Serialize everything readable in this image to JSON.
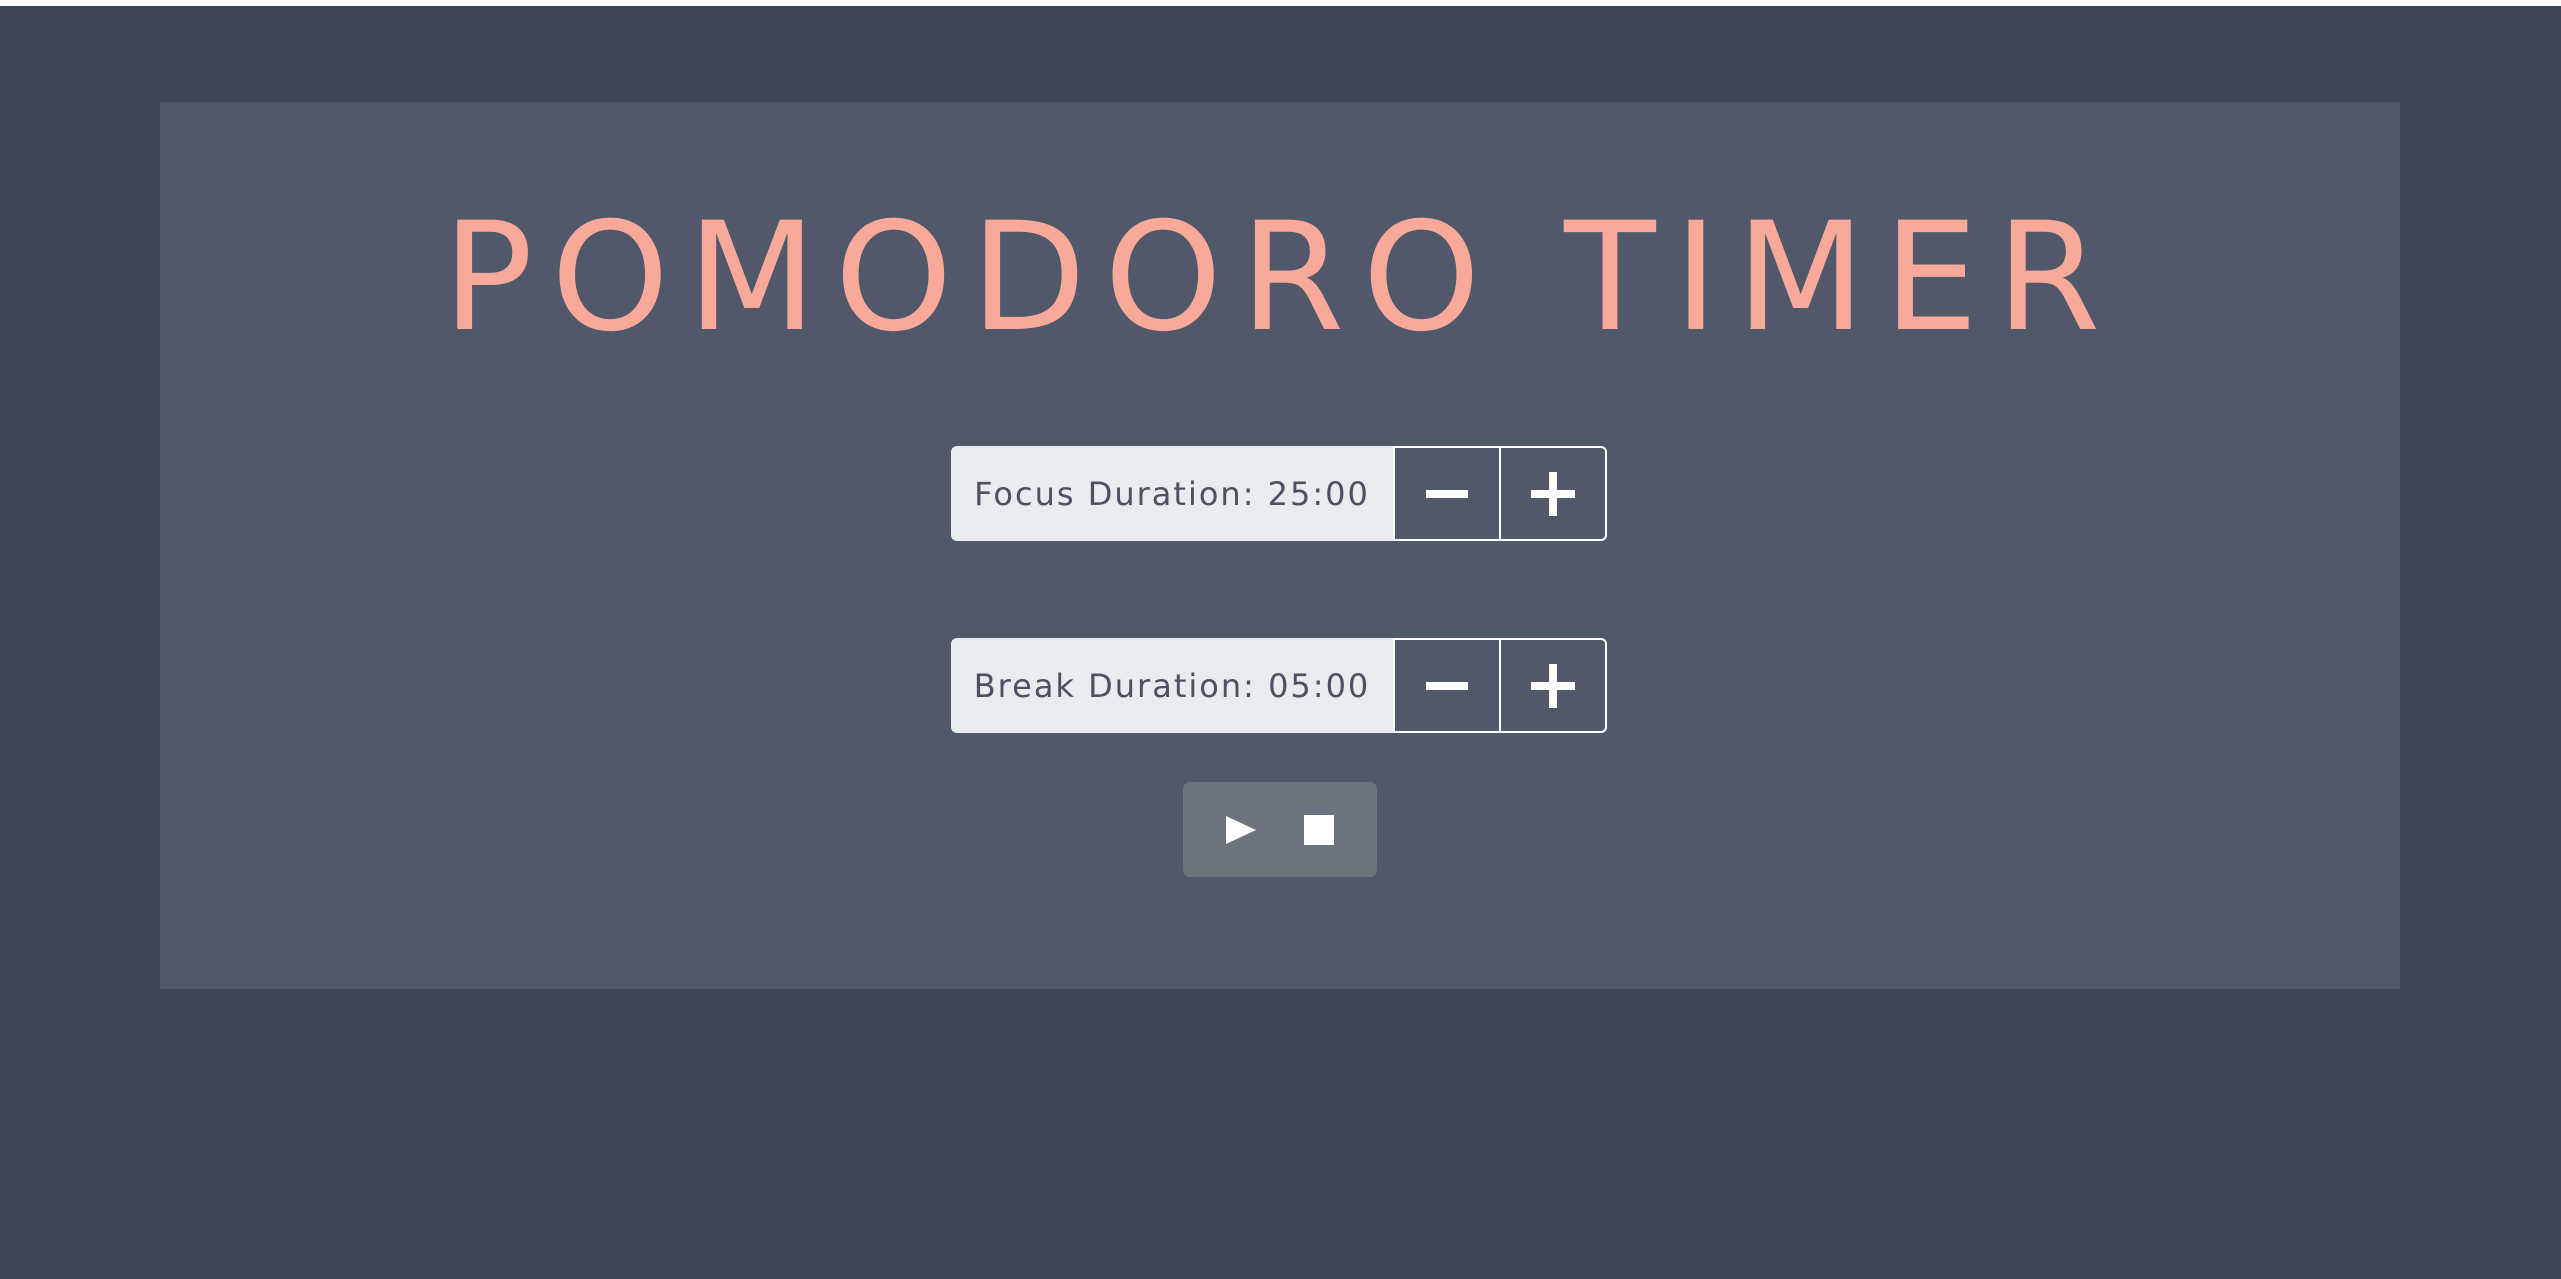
{
  "app": {
    "title": "POMODORO TIMER"
  },
  "focus": {
    "label": "Focus Duration: 25:00",
    "decrease_icon": "minus-icon",
    "increase_icon": "plus-icon"
  },
  "break": {
    "label": "Break Duration: 05:00",
    "decrease_icon": "minus-icon",
    "increase_icon": "plus-icon"
  },
  "controls": {
    "start_icon": "play-icon",
    "stop_icon": "stop-icon"
  },
  "colors": {
    "page_background": "#3d4659",
    "panel_background": "#515869",
    "title_accent": "#f8a99a",
    "label_background": "#e8ecee",
    "label_text": "#4b5160",
    "controls_background": "#6c737e",
    "icon": "#ffffff"
  }
}
